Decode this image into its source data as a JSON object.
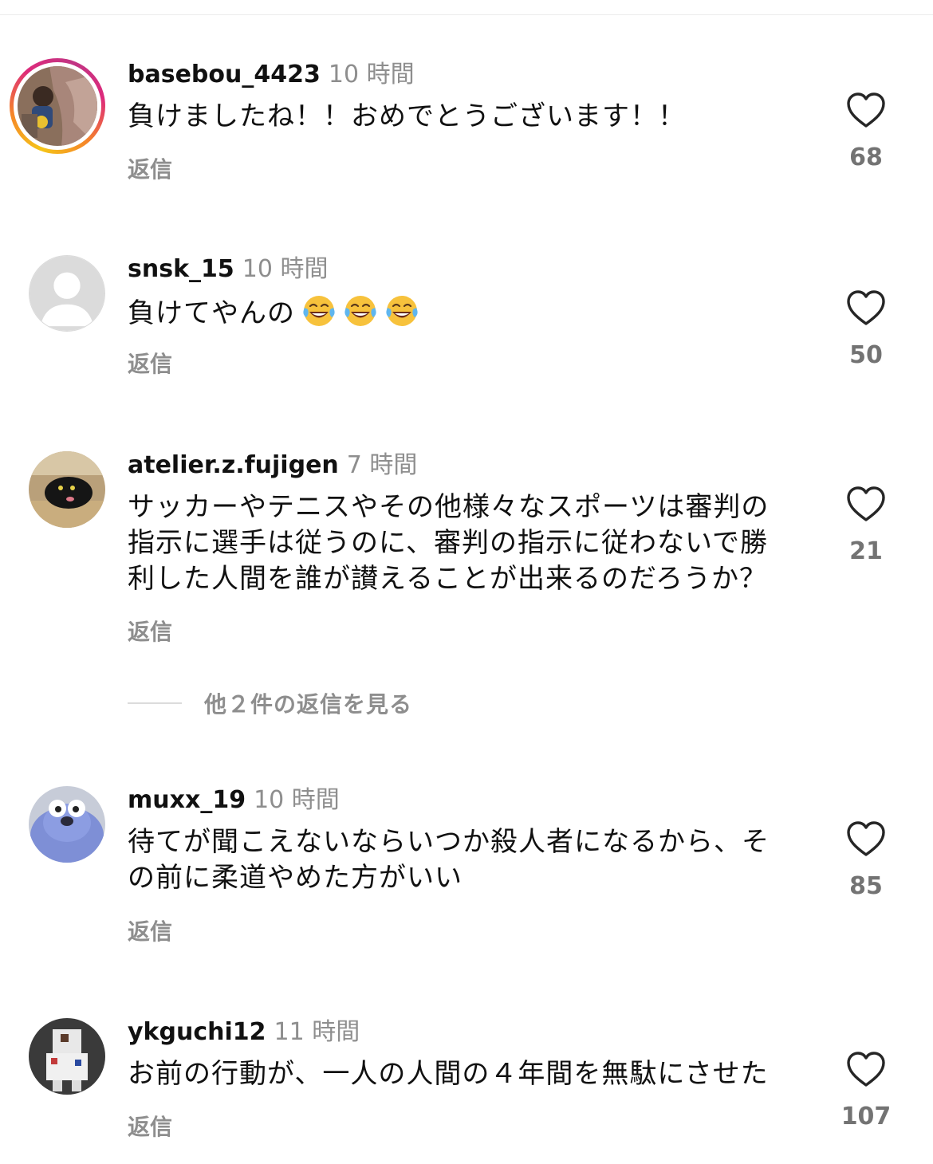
{
  "comments": [
    {
      "username": "basebou_4423",
      "time": "10 時間",
      "text": "負けましたね！！おめでとうございます！！",
      "reply_label": "返信",
      "likes": "68",
      "has_story_ring": true
    },
    {
      "username": "snsk_15",
      "time": "10 時間",
      "text": "負けてやんの",
      "emojis": [
        "face-with-tears-of-joy",
        "face-with-tears-of-joy",
        "face-with-tears-of-joy"
      ],
      "reply_label": "返信",
      "likes": "50"
    },
    {
      "username": "atelier.z.fujigen",
      "time": "7 時間",
      "text_lines": [
        "サッカーやテニスやその他様々なスポーツは審判の",
        "指示に選手は従うのに、審判の指示に従わないで勝",
        "利した人間を誰が讃えることが出来るのだろうか？"
      ],
      "reply_label": "返信",
      "likes": "21",
      "view_replies": "他２件の返信を見る"
    },
    {
      "username": "muxx_19",
      "time": "10 時間",
      "text_lines": [
        "待てが聞こえないならいつか殺人者になるから、そ",
        "の前に柔道やめた方がいい"
      ],
      "reply_label": "返信",
      "likes": "85"
    },
    {
      "username": "ykguchi12",
      "time": "11 時間",
      "text": "お前の行動が、一人の人間の４年間を無駄にさせた",
      "reply_label": "返信",
      "likes": "107"
    }
  ],
  "icons": {
    "like": "heart-outline-icon",
    "default_avatar": "default-avatar-icon"
  },
  "colors": {
    "secondary_text": "#8e8e8e",
    "like_count": "#737373",
    "story_ring": [
      "#f5c518",
      "#f58529",
      "#dd2a7b"
    ]
  }
}
